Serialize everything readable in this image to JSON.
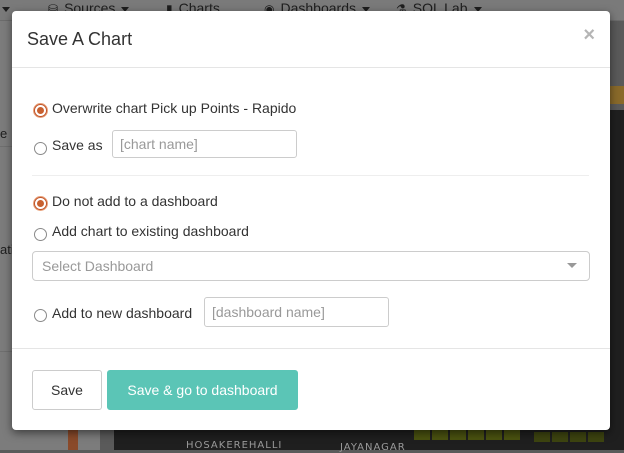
{
  "background": {
    "nav": [
      {
        "label": "Sources",
        "icon": "database-icon"
      },
      {
        "label": "Charts",
        "icon": "bar-chart-icon"
      },
      {
        "label": "Dashboards",
        "icon": "dashboard-icon"
      },
      {
        "label": "SQL Lab",
        "icon": "flask-icon"
      }
    ],
    "map_labels": [
      "HOSAKEREHALLI",
      "JAYANAGAR"
    ],
    "left_fragments": [
      "e",
      "ation"
    ]
  },
  "modal": {
    "title": "Save A Chart",
    "close_symbol": "×",
    "save_action": {
      "overwrite_label": "Overwrite chart Pick up Points - Rapido",
      "overwrite_checked": true,
      "save_as_label": "Save as",
      "save_as_checked": false,
      "chart_name_placeholder": "[chart name]"
    },
    "dashboard": {
      "no_dashboard_label": "Do not add to a dashboard",
      "no_dashboard_checked": true,
      "existing_label": "Add chart to existing dashboard",
      "existing_checked": false,
      "select_placeholder": "Select Dashboard",
      "new_label": "Add to new dashboard",
      "new_checked": false,
      "dashboard_name_placeholder": "[dashboard name]"
    },
    "footer": {
      "save_label": "Save",
      "save_go_label": "Save & go to dashboard"
    }
  },
  "colors": {
    "accent": "#5bc5b6",
    "radio_checked": "#c8602f",
    "overlay": "#5a5a5a"
  }
}
